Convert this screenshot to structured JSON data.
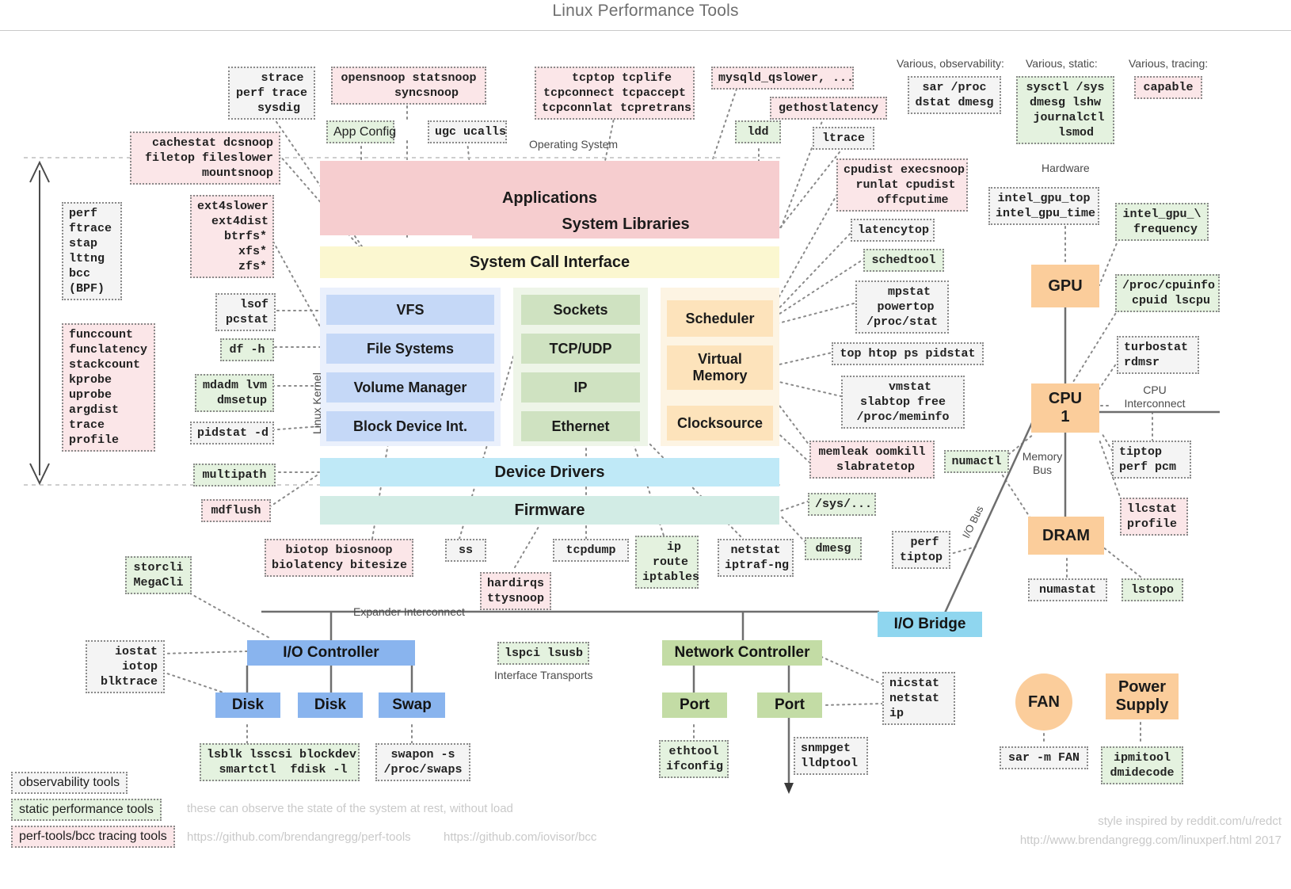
{
  "page_title": "Linux Performance Tools",
  "section_labels": {
    "operating_system": "Operating System",
    "hardware": "Hardware",
    "linux_kernel": "Linux Kernel",
    "various_observability": "Various, observability:",
    "various_static": "Various, static:",
    "various_tracing": "Various, tracing:",
    "cpu_interconnect": "CPU\nInterconnect",
    "memory_bus": "Memory\nBus",
    "io_bus": "I/O Bus",
    "expander_interconnect": "Expander Interconnect",
    "interface_transports": "Interface Transports"
  },
  "layers": {
    "applications": "Applications",
    "system_libraries": "System Libraries",
    "system_call_interface": "System Call Interface",
    "device_drivers": "Device Drivers",
    "firmware": "Firmware",
    "fs_stack": [
      "VFS",
      "File Systems",
      "Volume Manager",
      "Block Device Int."
    ],
    "net_stack": [
      "Sockets",
      "TCP/UDP",
      "IP",
      "Ethernet"
    ],
    "cpu_stack": [
      "Scheduler",
      "Virtual\nMemory",
      "Clocksource"
    ]
  },
  "hardware": {
    "gpu": "GPU",
    "cpu1": "CPU\n1",
    "dram": "DRAM",
    "fan": "FAN",
    "power_supply": "Power\nSupply",
    "io_bridge": "I/O Bridge",
    "io_controller": "I/O Controller",
    "disk1": "Disk",
    "disk2": "Disk",
    "swap": "Swap",
    "network_controller": "Network Controller",
    "port1": "Port",
    "port2": "Port"
  },
  "tools": {
    "strace": "   strace\nperf trace\n  sysdig",
    "opensnoop": "opensnoop statsnoop\n     syncsnoop",
    "tcptop": "  tcptop tcplife\ntcpconnect tcpaccept\ntcpconnlat tcpretrans",
    "mysqld_qslower": "mysqld_qslower, ...",
    "gethostlatency": "gethostlatency",
    "sar_proc": "sar /proc\ndstat dmesg",
    "sysctl": "sysctl /sys\ndmesg lshw\n journalctl\n   lsmod",
    "capable": "capable",
    "app_config": "App Config",
    "ugc_ucalls": "ugc ucalls",
    "ldd": "ldd",
    "ltrace": "ltrace",
    "cachestat": "cachestat dcsnoop\nfiletop fileslower\n      mountsnoop",
    "cpudist": "cpudist execsnoop\n runlat cpudist\n   offcputime",
    "intel_gpu_top": "intel_gpu_top\nintel_gpu_time",
    "intel_gpu_freq": "intel_gpu_\\\n frequency",
    "perf_ftrace": "perf\nftrace\nstap\nlttng\nbcc\n(BPF)",
    "ext4slower": "ext4slower\n  ext4dist\n   btrfs*\n     xfs*\n     zfs*",
    "latencytop": "latencytop",
    "schedtool": "schedtool",
    "proc_cpuinfo": "/proc/cpuinfo\n cpuid lscpu",
    "lsof": "  lsof\npcstat",
    "mpstat": "  mpstat\n powertop\n/proc/stat",
    "funccount": "funccount\nfunclatency\nstackcount\nkprobe\nuprobe\nargdist\ntrace\nprofile",
    "df_h": "df -h",
    "top_htop": "top htop ps pidstat",
    "turbostat": "turbostat\nrdmsr",
    "mdadm": "mdadm lvm\n  dmsetup",
    "vmstat": "  vmstat\nslabtop free\n/proc/meminfo",
    "pidstat_d": "pidstat -d",
    "memleak": "memleak oomkill\n slabratetop",
    "numactl": "numactl",
    "tiptop_perf_pcm": "tiptop\nperf pcm",
    "multipath": "multipath",
    "sys_dots": "/sys/...",
    "llcstat": "llcstat\nprofile",
    "mdflush": "mdflush",
    "biotop": "biotop biosnoop\nbiolatency bitesize",
    "ss": "ss",
    "tcpdump": "tcpdump",
    "ip_route": "  ip\n route\niptables",
    "netstat_iptraf": "netstat\niptraf-ng",
    "dmesg": "dmesg",
    "perf_tiptop": " perf\ntiptop",
    "storcli": "storcli\nMegaCli",
    "hardirqs": "hardirqs\nttysnoop",
    "numastat": "numastat",
    "lstopo": "lstopo",
    "iostat": " iostat\n iotop\nblktrace",
    "lspci_lsusb": "lspci lsusb",
    "nicstat": "nicstat\nnetstat\nip",
    "lsblk": "lsblk lsscsi blockdev\n smartctl  fdisk -l",
    "swapon": "swapon -s\n/proc/swaps",
    "ethtool": "ethtool\nifconfig",
    "snmpget": "snmpget\nlldptool",
    "sar_m_fan": "sar -m FAN",
    "ipmitool": "ipmitool\ndmidecode"
  },
  "legend": {
    "observability": "observability tools",
    "static": "static performance tools",
    "tracing": "perf-tools/bcc tracing tools",
    "static_note": "these can observe the state of the system at rest, without load",
    "link_perf_tools": "https://github.com/brendangregg/perf-tools",
    "link_bcc": "https://github.com/iovisor/bcc",
    "credit_style": "style inspired by reddit.com/u/redct",
    "credit_url": "http://www.brendangregg.com/linuxperf.html 2017"
  },
  "colors": {
    "observability_bg": "#f4f4f4",
    "static_bg": "#e4f2df",
    "tracing_bg": "#fbe6e8",
    "applications": "#f6cdcf",
    "syscall": "#fbf7d0",
    "filesystem": "#c5d8f7",
    "network": "#cfe2c1",
    "cpu": "#fde3bb",
    "drivers": "#bfe9f7",
    "firmware": "#d2ece5",
    "hardware": "#fbcd9b",
    "io_blue": "#89b4ee",
    "bridge_blue": "#8fd6ef",
    "nic_green": "#c3dca5"
  }
}
